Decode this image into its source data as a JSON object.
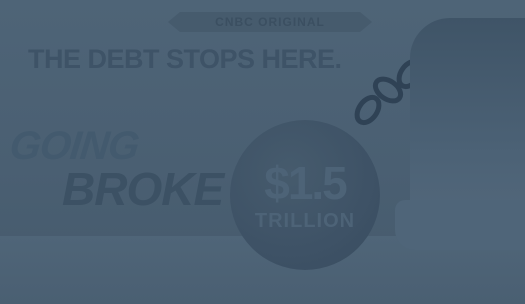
{
  "poster": {
    "badge": "CNBC ORIGINAL",
    "headline": "THE DEBT STOPS HERE.",
    "title_line1": "GOING",
    "title_line2": "BROKE",
    "ball_amount": "$1.5",
    "ball_unit": "TRILLION"
  },
  "colors": {
    "background": "#4a5f72",
    "text_dark": "#3e5367"
  }
}
